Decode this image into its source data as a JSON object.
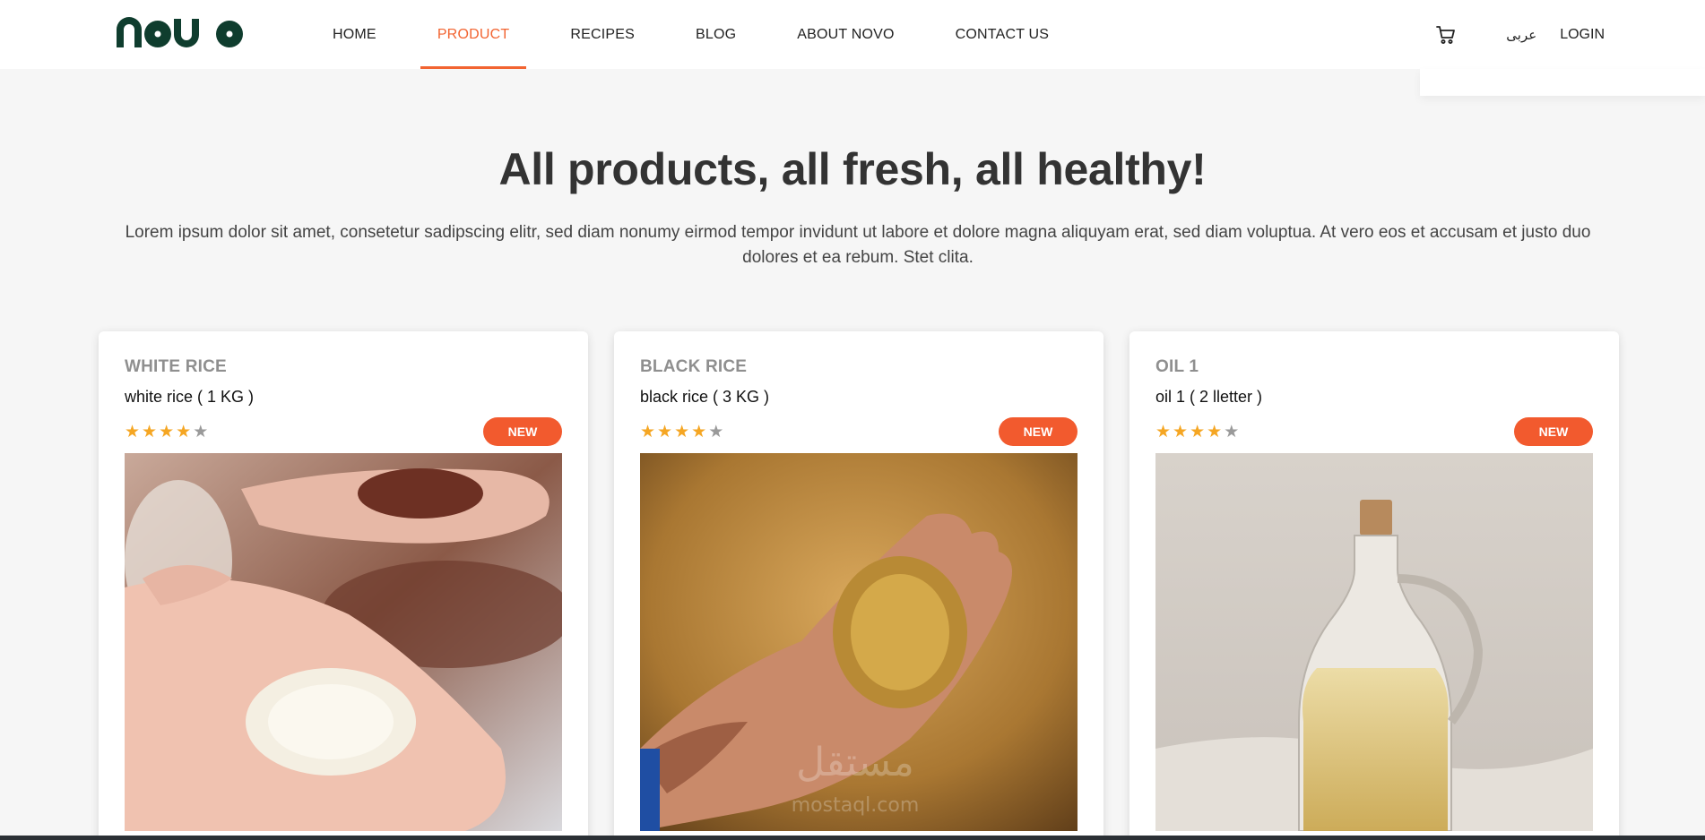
{
  "brand": {
    "logo_text": "novo",
    "logo_color": "#0f3d2e"
  },
  "nav": {
    "items": [
      {
        "label": "HOME",
        "active": false
      },
      {
        "label": "PRODUCT",
        "active": true
      },
      {
        "label": "RECIPES",
        "active": false
      },
      {
        "label": "BLOG",
        "active": false
      },
      {
        "label": "ABOUT NOVO",
        "active": false
      },
      {
        "label": "CONTACT US",
        "active": false
      }
    ],
    "accent_color": "#f26431"
  },
  "header_right": {
    "cart_icon": "cart-icon",
    "language": "عربى",
    "login": "LOGIN"
  },
  "hero": {
    "title": "All products, all fresh, all healthy!",
    "description": "Lorem ipsum dolor sit amet, consetetur sadipscing elitr, sed diam nonumy eirmod tempor invidunt ut labore et dolore magna aliquyam erat, sed diam voluptua. At vero eos et accusam et justo duo dolores et ea rebum. Stet clita."
  },
  "products": [
    {
      "category": "WHITE RICE",
      "name": "white rice ( 1 KG )",
      "rating": 4,
      "max_rating": 5,
      "badge": "NEW",
      "image": "hands holding white and brown rice"
    },
    {
      "category": "BLACK RICE",
      "name": "black rice ( 3 KG )",
      "rating": 4,
      "max_rating": 5,
      "badge": "NEW",
      "image": "hand holding paddy rice grains"
    },
    {
      "category": "OIL 1",
      "name": "oil 1 ( 2 lletter )",
      "rating": 4,
      "max_rating": 5,
      "badge": "NEW",
      "image": "glass jug of oil"
    }
  ],
  "watermark": {
    "arabic": "مستقل",
    "latin": "mostaql.com"
  },
  "colors": {
    "badge": "#f25a2e",
    "star_on": "#f5a623",
    "star_off": "#9a9a9a"
  }
}
